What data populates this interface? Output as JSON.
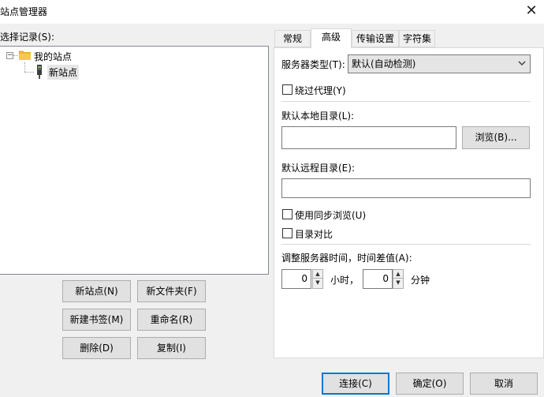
{
  "window": {
    "title": "站点管理器",
    "close_glyph": "✕"
  },
  "left": {
    "select_label": "选择记录(S):",
    "tree": {
      "toggle_glyph": "−",
      "root": {
        "label": "我的站点",
        "icon": "folder-icon"
      },
      "children": [
        {
          "label": "新站点",
          "icon": "server-icon"
        }
      ]
    },
    "buttons": {
      "new_site": "新站点(N)",
      "new_folder": "新文件夹(F)",
      "new_bookmark": "新建书签(M)",
      "rename": "重命名(R)",
      "delete": "删除(D)",
      "copy": "复制(I)"
    }
  },
  "tabs": [
    {
      "label": "常规",
      "active": false
    },
    {
      "label": "高级",
      "active": true
    },
    {
      "label": "传输设置",
      "active": false
    },
    {
      "label": "字符集",
      "active": false
    }
  ],
  "advanced": {
    "server_type_label": "服务器类型(T):",
    "server_type_value": "默认(自动检测)",
    "bypass_proxy": {
      "label": "绕过代理(Y)",
      "checked": false
    },
    "local_dir_label": "默认本地目录(L):",
    "local_dir_value": "",
    "browse_label": "浏览(B)...",
    "remote_dir_label": "默认远程目录(E):",
    "remote_dir_value": "",
    "sync_browse": {
      "label": "使用同步浏览(U)",
      "checked": false
    },
    "dir_compare": {
      "label": "目录对比",
      "checked": false
    },
    "time_adjust_label": "调整服务器时间，时间差值(A):",
    "hours_value": "0",
    "hours_unit": "小时，",
    "minutes_value": "0",
    "minutes_unit": "分钟",
    "spin_up": "▲",
    "spin_down": "▼"
  },
  "footer": {
    "connect": "连接(C)",
    "ok": "确定(O)",
    "cancel": "取消"
  },
  "colors": {
    "accent": "#0078d7",
    "folder": "#f3b62b",
    "server": "#4a7a3a"
  }
}
